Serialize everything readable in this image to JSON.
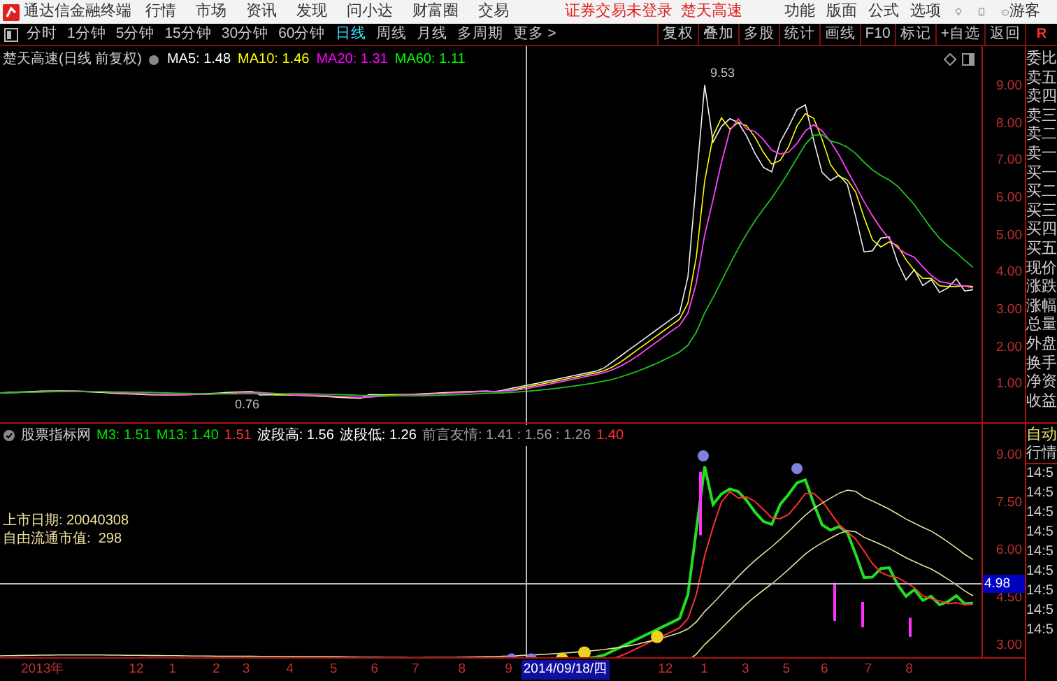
{
  "menu_bar": {
    "app_name": "通达信金融终端",
    "items": [
      "行情",
      "市场",
      "资讯",
      "发现",
      "问小达",
      "财富圈",
      "交易"
    ],
    "login_notice": "证券交易未登录",
    "stock_name": "楚天高速",
    "right_items": [
      "功能",
      "版面",
      "公式",
      "选项"
    ],
    "user": "游客"
  },
  "toolbar": {
    "periods": [
      {
        "label": "分时",
        "selected": false
      },
      {
        "label": "1分钟",
        "selected": false
      },
      {
        "label": "5分钟",
        "selected": false
      },
      {
        "label": "15分钟",
        "selected": false
      },
      {
        "label": "30分钟",
        "selected": false
      },
      {
        "label": "60分钟",
        "selected": false
      },
      {
        "label": "日线",
        "selected": true
      },
      {
        "label": "周线",
        "selected": false
      },
      {
        "label": "月线",
        "selected": false
      },
      {
        "label": "多周期",
        "selected": false
      },
      {
        "label": "更多 >",
        "selected": false
      }
    ],
    "tools": [
      "复权",
      "叠加",
      "多股",
      "统计",
      "画线",
      "F10",
      "标记",
      "+自选",
      "返回"
    ],
    "side_label": "R"
  },
  "main_chart": {
    "title": "楚天高速(日线 前复权)",
    "indicators": [
      {
        "label": "MA5: 1.48",
        "color": "#ffffff"
      },
      {
        "label": "MA10: 1.46",
        "color": "#ffff00"
      },
      {
        "label": "MA20: 1.31",
        "color": "#ff00ff"
      },
      {
        "label": "MA60: 1.11",
        "color": "#00ff00"
      }
    ],
    "annotations": [
      "9.53",
      "0.76"
    ],
    "yticks": [
      "9.00",
      "8.00",
      "7.00",
      "6.00",
      "5.00",
      "4.00",
      "3.00",
      "2.00",
      "1.00"
    ]
  },
  "indicator_panel": {
    "title": "股票指标网",
    "values": [
      {
        "label": "M3: 1.51",
        "color": "#00e000"
      },
      {
        "label": "M13: 1.40",
        "color": "#00e000"
      },
      {
        "label": "1.51",
        "color": "#ff3030"
      },
      {
        "label": "波段高: 1.56",
        "color": "#ffffff"
      },
      {
        "label": "波段低: 1.26",
        "color": "#ffffff"
      },
      {
        "label": "前言友情: 1.41 : 1.56 : 1.26",
        "color": "#a0a0a0"
      },
      {
        "label": "1.40",
        "color": "#ff3030"
      }
    ],
    "info": [
      "上市日期: 20040308",
      "自由流通市值:  298"
    ],
    "yticks": [
      "9.00",
      "7.50",
      "6.00",
      "4.50",
      "3.00"
    ],
    "cursor_value": "4.98"
  },
  "date_axis": {
    "labels": [
      {
        "label": "2013年",
        "selected": false
      },
      {
        "label": "12",
        "selected": false
      },
      {
        "label": "1",
        "selected": false
      },
      {
        "label": "2",
        "selected": false
      },
      {
        "label": "3",
        "selected": false
      },
      {
        "label": "4",
        "selected": false
      },
      {
        "label": "5",
        "selected": false
      },
      {
        "label": "6",
        "selected": false
      },
      {
        "label": "7",
        "selected": false
      },
      {
        "label": "8",
        "selected": false
      },
      {
        "label": "9",
        "selected": false
      },
      {
        "label": "2014/09/18/四",
        "selected": true
      },
      {
        "label": "12",
        "selected": false
      },
      {
        "label": "1",
        "selected": false
      },
      {
        "label": "3",
        "selected": false
      },
      {
        "label": "5",
        "selected": false
      },
      {
        "label": "6",
        "selected": false
      },
      {
        "label": "7",
        "selected": false
      },
      {
        "label": "8",
        "selected": false
      }
    ]
  },
  "quote_panel": {
    "labels": [
      "委比",
      "卖五",
      "卖四",
      "卖三",
      "卖二",
      "卖一",
      "买一",
      "买二",
      "买三",
      "买四",
      "买五",
      "现价",
      "涨跌",
      "涨幅",
      "总量",
      "外盘",
      "换手",
      "净资",
      "收益"
    ],
    "tab": "自动",
    "title": "行情",
    "times": [
      "14:5",
      "14:5",
      "14:5",
      "14:5",
      "14:5",
      "14:5",
      "14:5",
      "14:5",
      "14:5"
    ]
  }
}
